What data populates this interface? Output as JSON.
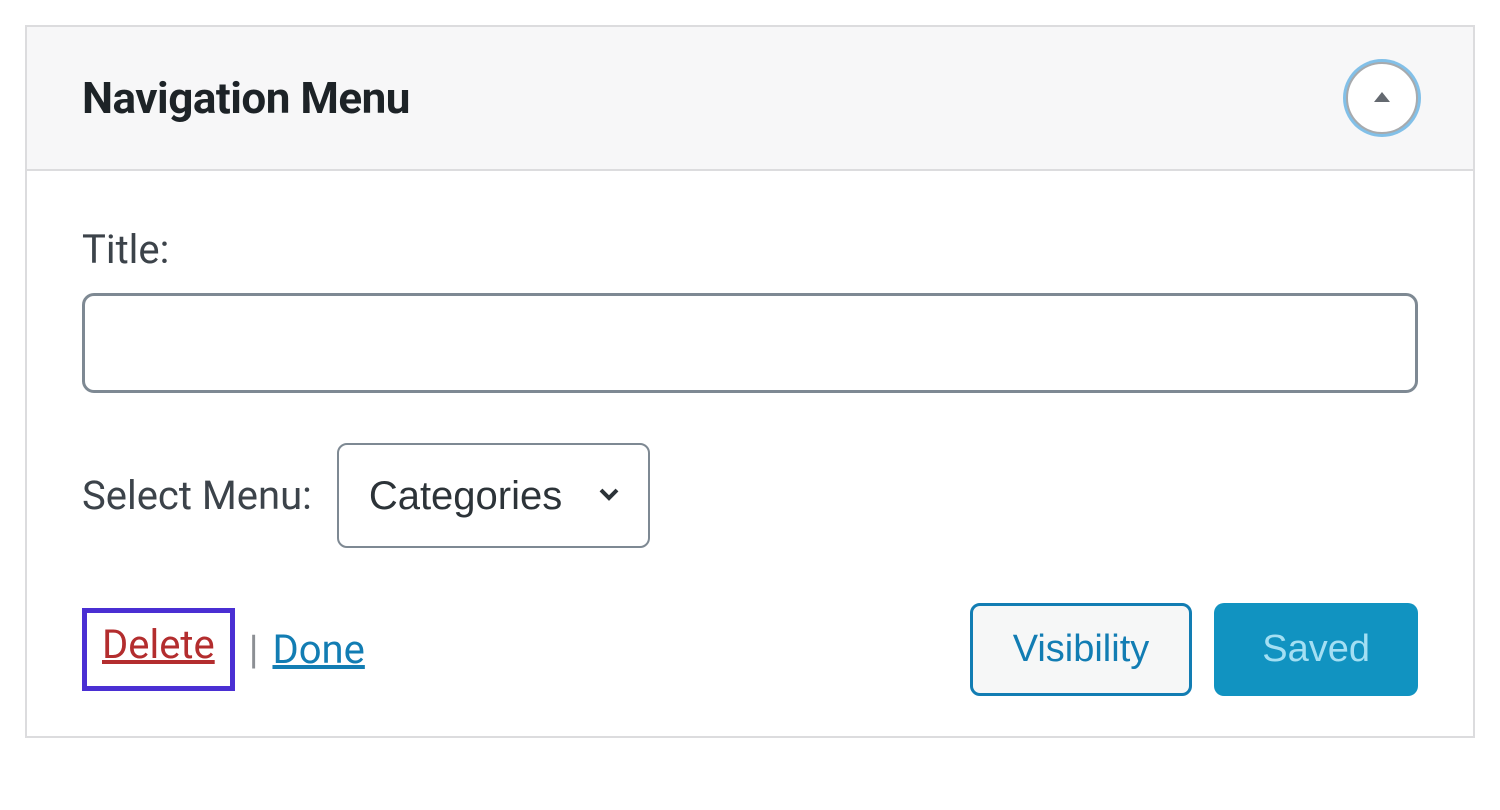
{
  "widget": {
    "title": "Navigation Menu",
    "fields": {
      "title_label": "Title:",
      "title_value": "",
      "select_label": "Select Menu:",
      "select_value": "Categories"
    },
    "actions": {
      "delete_label": "Delete",
      "separator": "|",
      "done_label": "Done",
      "visibility_label": "Visibility",
      "saved_label": "Saved"
    }
  }
}
